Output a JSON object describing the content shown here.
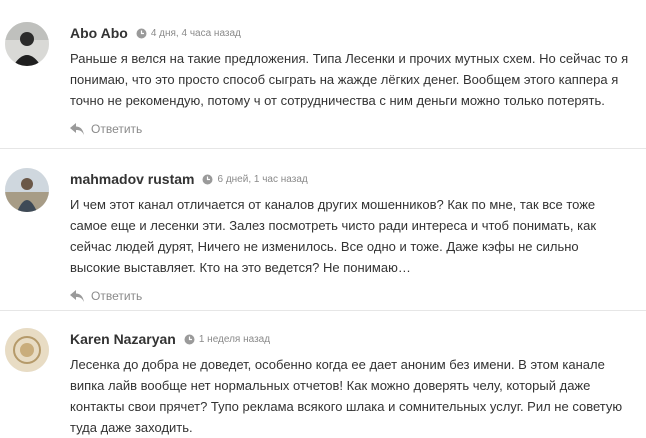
{
  "comments": [
    {
      "author": "Abo Abo",
      "time": "4 дня, 4 часа назад",
      "text": "Раньше я велся на такие предложения. Типа Лесенки и прочих мутных схем. Но сейчас то я понимаю, что это просто способ сыграть на жажде лёгких денег. Вообщем этого каппера я точно не рекомендую, потому ч от сотрудничества с ним деньги можно только потерять.",
      "reply_label": "Ответить"
    },
    {
      "author": "mahmadov rustam",
      "time": "6 дней, 1 час назад",
      "text": "И чем этот канал отличается от каналов других мошенников? Как по мне, так все тоже самое еще и лесенки эти. Залез посмотреть чисто ради интереса и чтоб понимать, как сейчас людей дурят, Ничего не изменилось. Все одно и тоже. Даже кэфы не сильно высокие выставляет. Кто на это ведется? Не понимаю…",
      "reply_label": "Ответить"
    },
    {
      "author": "Karen Nazaryan",
      "time": "1 неделя назад",
      "text": "Лесенка до добра не доведет, особенно когда ее дает аноним без имени. В этом канале випка лайв вообще нет нормальных отчетов! Как можно доверять челу, который даже контакты свои прячет? Тупо реклама всякого шлака и сомнительных услуг. Рил не советую туда даже заходить."
    }
  ]
}
